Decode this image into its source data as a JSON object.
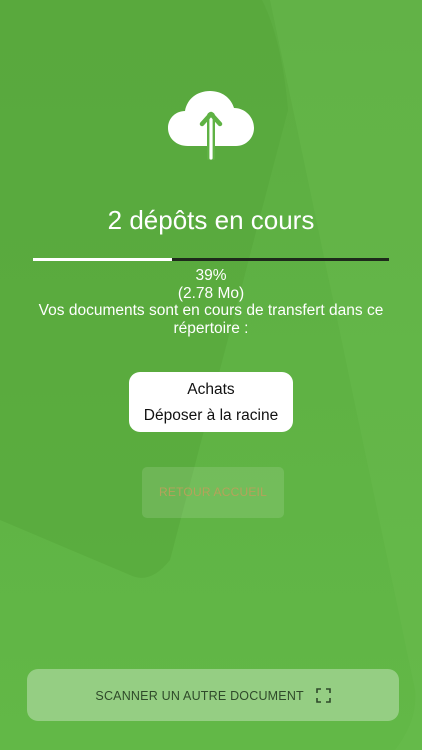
{
  "status": {
    "title": "2 dépôts en cours",
    "progress_fraction": 0.39,
    "percent_text": "39%",
    "size_text": "(2.78 Mo)",
    "message": "Vos documents sont en cours de transfert dans ce répertoire :"
  },
  "folder": {
    "name": "Achats",
    "action": "Déposer à la racine"
  },
  "buttons": {
    "return_home": "RETOUR ACCUEIL",
    "scan_another": "SCANNER UN AUTRE DOCUMENT"
  },
  "icons": {
    "upload": "cloud-upload-icon",
    "scan": "scan-frame-icon"
  },
  "colors": {
    "background": "#5fb244",
    "progress_track": "#1e2a1b",
    "progress_fill": "#ffffff",
    "return_text": "#b6a25b"
  }
}
